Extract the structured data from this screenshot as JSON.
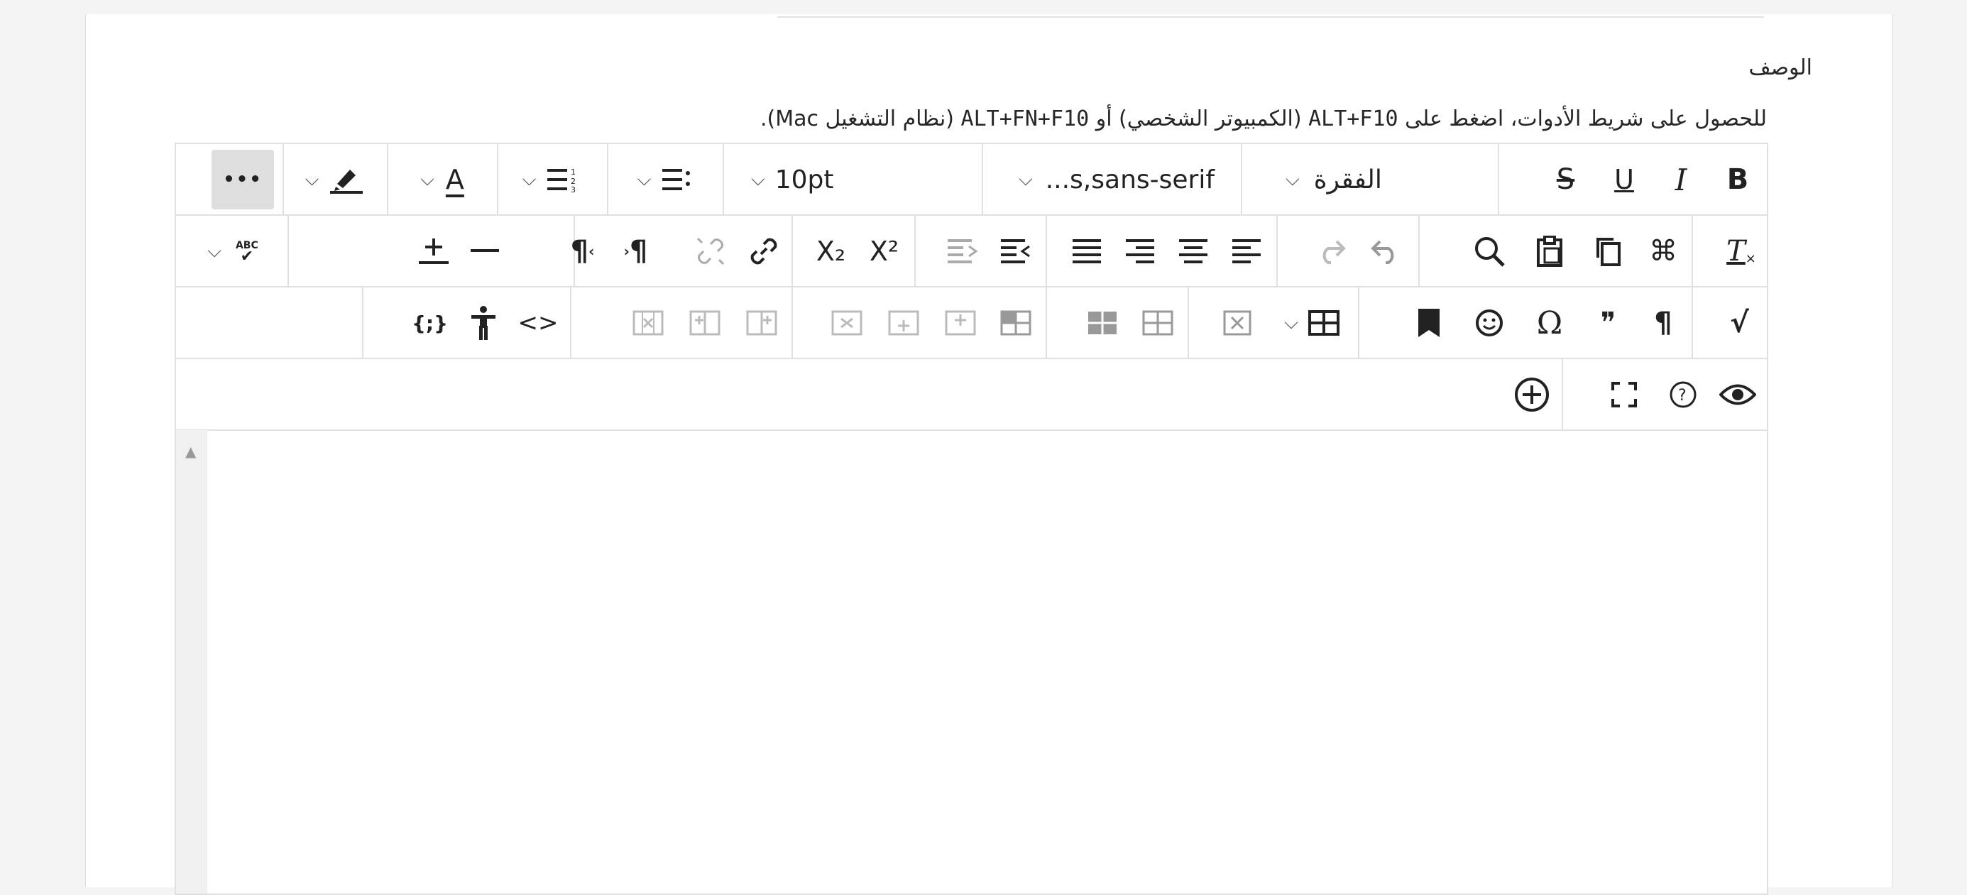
{
  "field": {
    "label": "الوصف",
    "hint_prefix": "للحصول على شريط الأدوات، اضغط على",
    "hint_key_pc": "ALT+F10",
    "hint_pc": "(الكمبيوتر الشخصي) أو",
    "hint_key_mac": "ALT+FN+F10",
    "hint_mac": "(نظام التشغيل Mac)."
  },
  "toolbar": {
    "bold": "B",
    "italic": "I",
    "underline": "U",
    "strike": "S",
    "block_format": "الفقرة",
    "font_family": "...s,sans-serif",
    "font_size": "10pt",
    "more": "•••",
    "text_color_letter": "A",
    "clear_format": "T",
    "superscript": "X²",
    "subscript": "X₂",
    "ltr": "¶",
    "rtl": "¶",
    "special_char": "Ω",
    "pilcrow": "¶",
    "quote": "❞",
    "code": "<>",
    "math": "√",
    "spellcheck": "ABC",
    "code_sample": "{;}"
  },
  "colors": {
    "border": "#e0e0e0",
    "more_bg": "#dedede",
    "icon": "#222222"
  }
}
